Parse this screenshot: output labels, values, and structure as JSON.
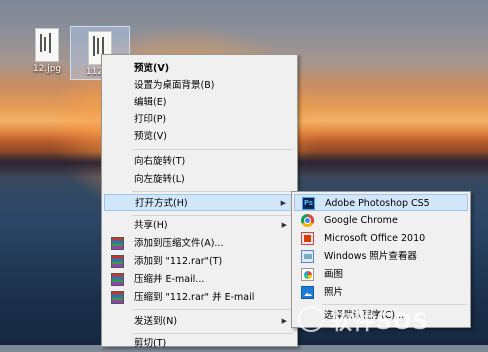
{
  "desktop": {
    "icons": [
      {
        "label": "12.jpg"
      },
      {
        "label": "112.jp"
      }
    ]
  },
  "context_menu": {
    "items": [
      {
        "label": "预览(V)"
      },
      {
        "label": "设置为桌面背景(B)"
      },
      {
        "label": "编辑(E)"
      },
      {
        "label": "打印(P)"
      },
      {
        "label": "预览(V)"
      },
      {
        "label": "向右旋转(T)"
      },
      {
        "label": "向左旋转(L)"
      },
      {
        "label": "打开方式(H)"
      },
      {
        "label": "共享(H)"
      },
      {
        "label": "添加到压缩文件(A)..."
      },
      {
        "label": "添加到 \"112.rar\"(T)"
      },
      {
        "label": "压缩并 E-mail..."
      },
      {
        "label": "压缩到 \"112.rar\" 并 E-mail"
      },
      {
        "label": "发送到(N)"
      },
      {
        "label": "剪切(T)"
      }
    ]
  },
  "open_with_menu": {
    "items": [
      {
        "label": "Adobe Photoshop CS5",
        "icon": "photoshop-icon"
      },
      {
        "label": "Google Chrome",
        "icon": "chrome-icon"
      },
      {
        "label": "Microsoft Office 2010",
        "icon": "office-icon"
      },
      {
        "label": "Windows 照片查看器",
        "icon": "photo-viewer-icon"
      },
      {
        "label": "画图",
        "icon": "paint-icon"
      },
      {
        "label": "照片",
        "icon": "photos-icon"
      },
      {
        "label": "选择默认程序(C)..."
      }
    ]
  },
  "watermark": {
    "text": "软件SOS"
  },
  "colors": {
    "menu_bg": "#f0f0f0",
    "highlight": "#d1e6f9",
    "highlight_border": "#9cc6ee"
  }
}
